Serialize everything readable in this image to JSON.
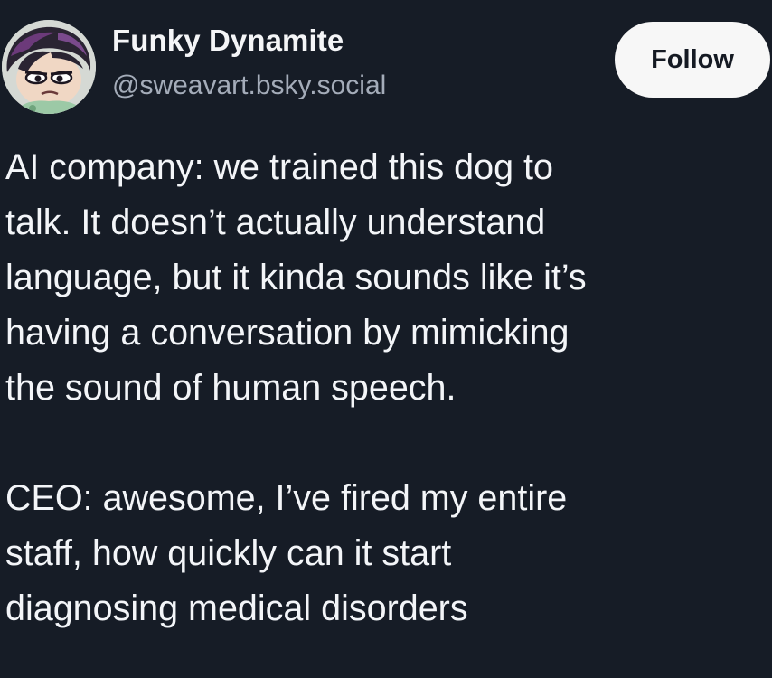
{
  "author": {
    "display_name": "Funky Dynamite",
    "handle": "@sweavart.bsky.social",
    "avatar_icon": "cartoon-character-avatar"
  },
  "actions": {
    "follow_label": "Follow"
  },
  "post": {
    "paragraphs": [
      "AI company: we trained this dog to\ntalk. It doesn’t actually understand\nlanguage, but it kinda sounds like it’s\nhaving a conversation by mimicking\nthe sound of human speech.",
      "CEO: awesome, I’ve fired my entire\nstaff, how quickly can it start\ndiagnosing medical disorders"
    ]
  },
  "colors": {
    "background": "#161c26",
    "text": "#f3f5f8",
    "handle": "#a4acb9",
    "button_bg": "#f7f7f7",
    "button_text": "#151a23"
  }
}
